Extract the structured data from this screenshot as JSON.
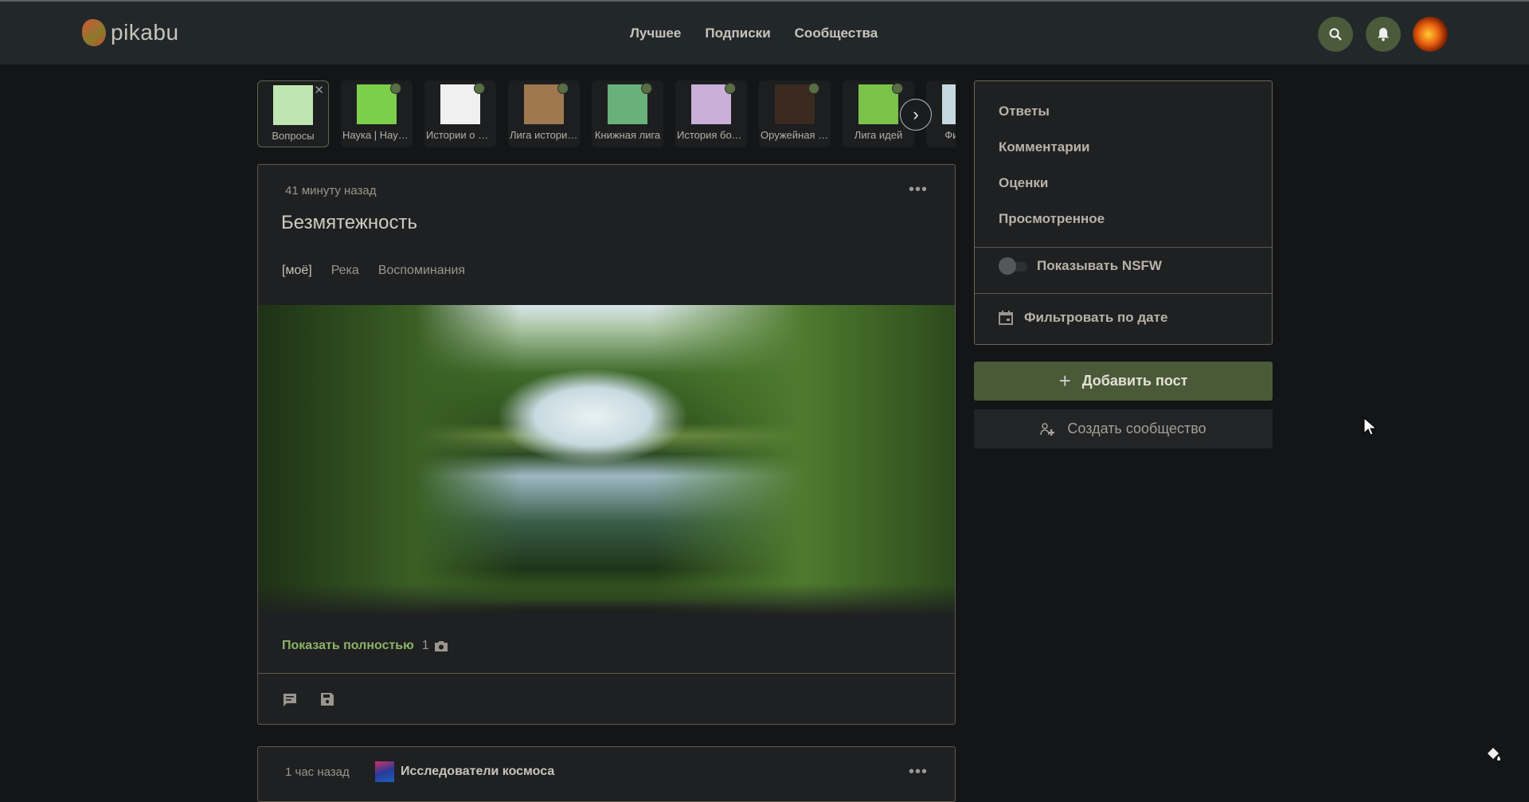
{
  "header": {
    "logo": "pikabu",
    "nav": [
      "Лучшее",
      "Подписки",
      "Сообщества"
    ]
  },
  "communities": [
    {
      "label": "Вопросы",
      "active": true,
      "color": "#bfe6b0"
    },
    {
      "label": "Наука | Научп…",
      "color": "#7ccf4a"
    },
    {
      "label": "Истории о жизни",
      "color": "#f0f0f0"
    },
    {
      "label": "Лига историков",
      "color": "#a07850"
    },
    {
      "label": "Книжная лига",
      "color": "#6ab07a"
    },
    {
      "label": "История болезни",
      "color": "#c8b0d8"
    },
    {
      "label": "Оружейная лига",
      "color": "#3a2a20"
    },
    {
      "label": "Лига идей",
      "color": "#7ac24a"
    },
    {
      "label": "Физика",
      "color": "#c8d8e0"
    }
  ],
  "post": {
    "time": "41 минуту назад",
    "title": "Безмятежность",
    "tags": [
      "[моё]",
      "Река",
      "Воспоминания"
    ],
    "show_full": "Показать полностью",
    "photo_count": "1"
  },
  "post2": {
    "time": "1 час назад",
    "community": "Исследователи космоса"
  },
  "sidebar": {
    "items": [
      "Ответы",
      "Комментарии",
      "Оценки",
      "Просмотренное"
    ],
    "nsfw": "Показывать NSFW",
    "nsfw_on": false,
    "date_filter": "Фильтровать по дате",
    "add_post": "Добавить пост",
    "create_community": "Создать сообщество"
  }
}
